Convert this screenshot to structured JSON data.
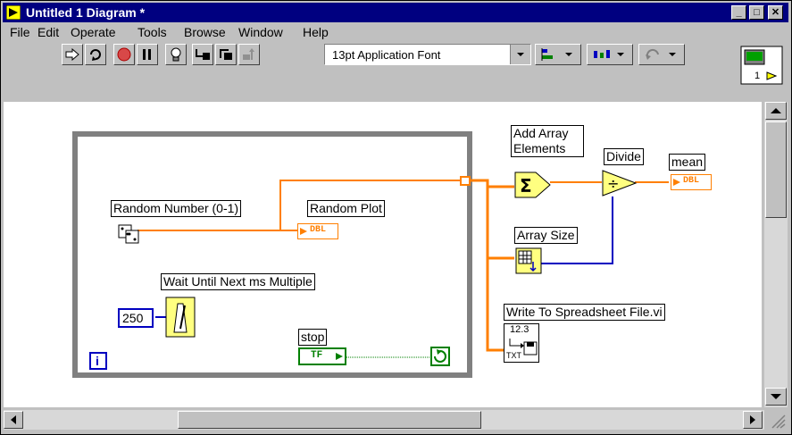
{
  "window": {
    "title": "Untitled 1 Diagram *",
    "min": "_",
    "max": "□",
    "close": "✕"
  },
  "menu": [
    {
      "label": "File"
    },
    {
      "label": "Edit"
    },
    {
      "label": "Operate"
    },
    {
      "label": "Tools"
    },
    {
      "label": "Browse"
    },
    {
      "label": "Window"
    },
    {
      "label": "Help"
    }
  ],
  "toolbar": {
    "font": "13pt Application Font",
    "connector_count": "1"
  },
  "diagram": {
    "random_label": "Random Number (0-1)",
    "plot_label": "Random Plot",
    "plot_type": "DBL",
    "wait_label": "Wait Until Next ms Multiple",
    "const_value": "250",
    "stop_label": "stop",
    "stop_type": "TF",
    "iter_label": "i",
    "add_label_1": "Add Array",
    "add_label_2": "Elements",
    "divide_label": "Divide",
    "mean_label": "mean",
    "mean_type": "DBL",
    "size_label": "Array Size",
    "write_label": "Write To Spreadsheet File.vi",
    "write_fmt": "12.3",
    "write_txt": "TXT",
    "sigma": "Σ",
    "divide_sym": "÷"
  },
  "colors": {
    "orange_wire": "#ff7f00",
    "blue_wire": "#0000c0",
    "green_wire": "#008000",
    "titlebar": "#000080"
  }
}
